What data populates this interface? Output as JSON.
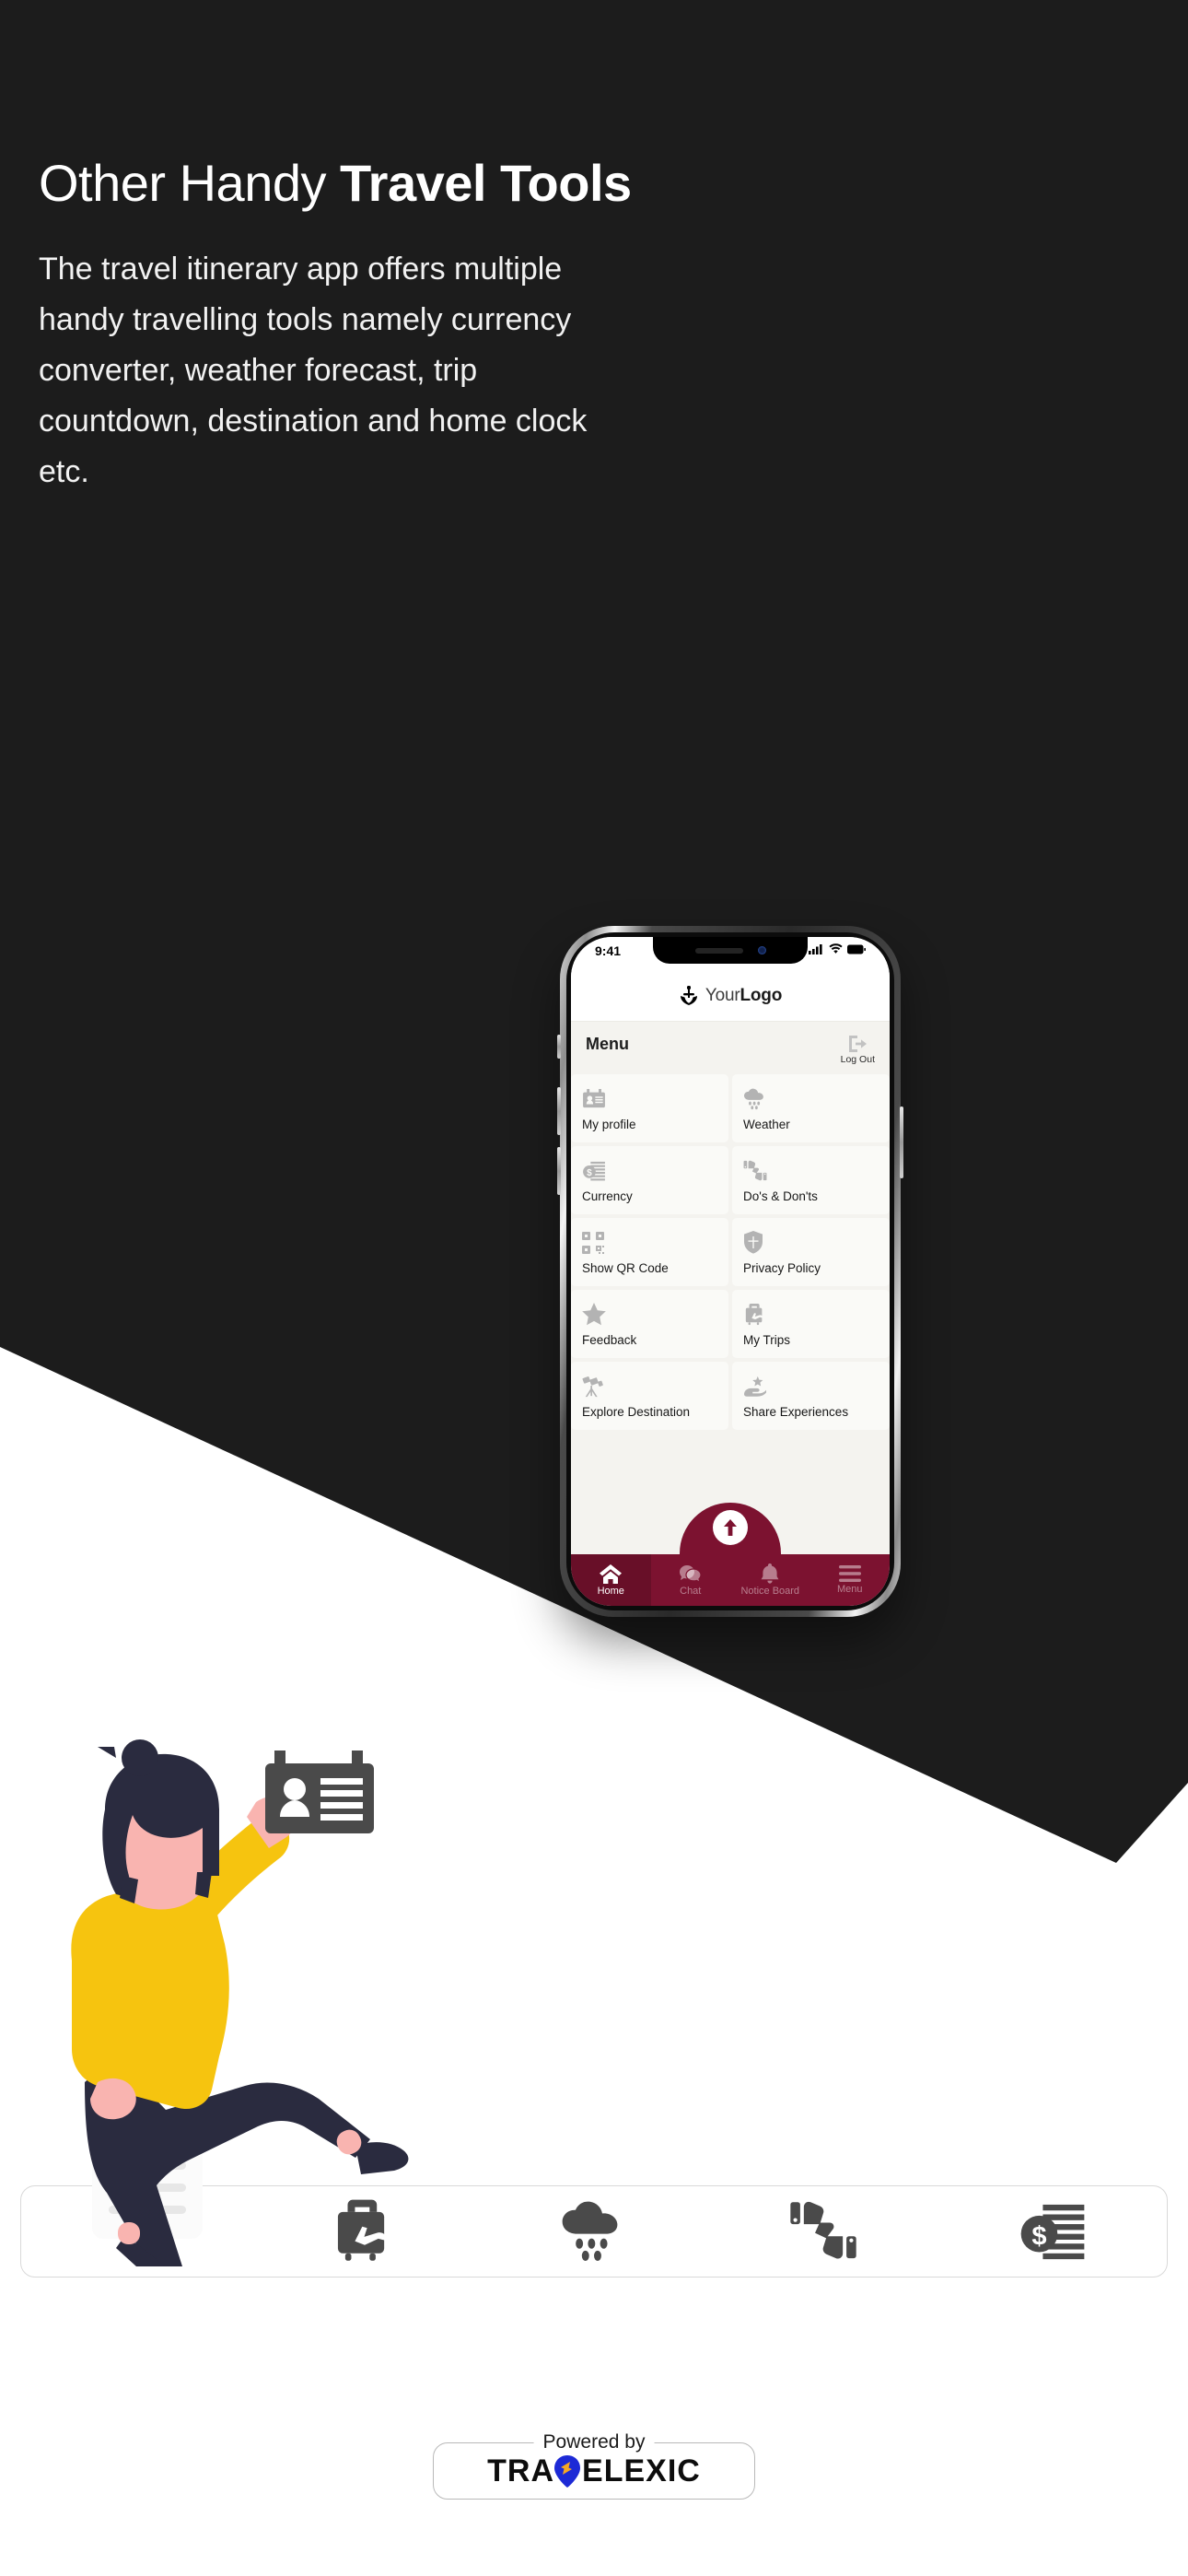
{
  "hero": {
    "headline_light": "Other Handy ",
    "headline_bold": "Travel Tools",
    "body": "The travel itinerary app offers multiple handy travelling tools namely currency converter, weather forecast, trip countdown, destination and home clock etc."
  },
  "phone": {
    "status": {
      "time": "9:41",
      "signal_icon": "cellular-bars-icon",
      "wifi_icon": "wifi-icon",
      "battery_icon": "battery-icon"
    },
    "app_header": {
      "logo_icon": "anchor-logo-icon",
      "logo_text_light": "Your",
      "logo_text_bold": "Logo"
    },
    "menu_bar": {
      "title": "Menu",
      "logout_label": "Log Out",
      "logout_icon": "logout-arrow-icon"
    },
    "tiles": [
      {
        "label": "My profile",
        "icon": "id-card-icon"
      },
      {
        "label": "Weather",
        "icon": "cloud-rain-icon"
      },
      {
        "label": "Currency",
        "icon": "coins-stack-icon"
      },
      {
        "label": "Do's & Don'ts",
        "icon": "thumbs-up-down-icon"
      },
      {
        "label": "Show QR Code",
        "icon": "qr-code-icon"
      },
      {
        "label": "Privacy Policy",
        "icon": "shield-icon"
      },
      {
        "label": "Feedback",
        "icon": "star-icon"
      },
      {
        "label": "My Trips",
        "icon": "suitcase-plane-icon"
      },
      {
        "label": "Explore Destination",
        "icon": "telescope-icon"
      },
      {
        "label": "Share Experiences",
        "icon": "hand-star-icon"
      }
    ],
    "fab": {
      "icon": "arrow-up-icon"
    },
    "bottom_nav": [
      {
        "label": "Home",
        "icon": "home-icon",
        "active": true
      },
      {
        "label": "Chat",
        "icon": "chat-icon",
        "active": false
      },
      {
        "label": "Notice Board",
        "icon": "bell-icon",
        "active": false
      },
      {
        "label": "Menu",
        "icon": "hamburger-icon",
        "active": false
      }
    ]
  },
  "feature_strip": {
    "icons": [
      "document-lines-icon",
      "suitcase-plane-icon",
      "cloud-rain-icon",
      "thumbs-up-down-icon",
      "coins-stack-icon"
    ]
  },
  "footer": {
    "powered_by": "Powered by",
    "brand_part1": "TRA",
    "brand_part2": "ELEXIC",
    "brand_pin_icon": "location-pin-icon"
  },
  "illustration": {
    "name": "woman-holding-id-card-illustration",
    "card_icon": "id-card-icon"
  },
  "colors": {
    "background_dark": "#1c1c1c",
    "background_light": "#ffffff",
    "accent_maroon": "#7c1230",
    "app_surface": "#f4f3ef",
    "tile_surface": "#fafaf7",
    "icon_grey": "#b3b3b3",
    "illustration_yellow": "#f6c40f",
    "illustration_navy": "#2a2b3f",
    "illustration_skin": "#f9b4b0",
    "brand_blue": "#1d2ad6",
    "brand_orange": "#f7a823"
  }
}
